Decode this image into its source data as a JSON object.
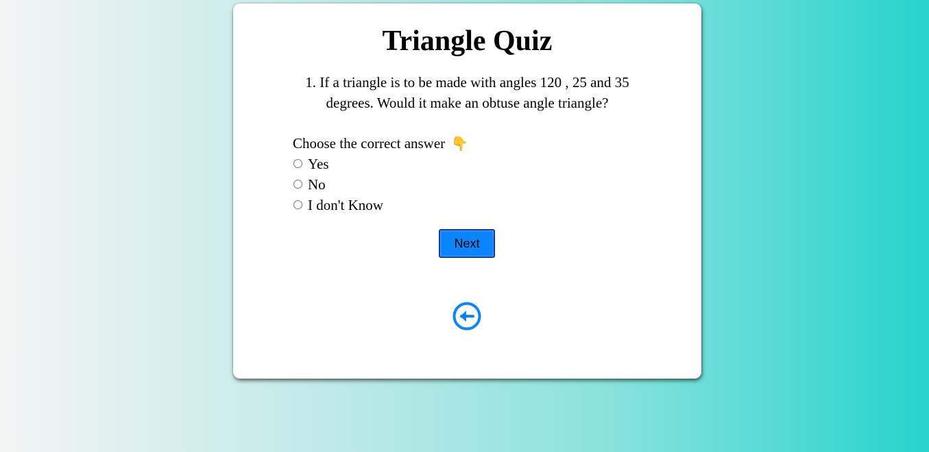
{
  "quiz": {
    "title": "Triangle Quiz",
    "question": "1. If a triangle is to be made with angles 120 , 25 and 35 degrees. Would it make an obtuse angle triangle?",
    "prompt": "Choose the correct answer",
    "prompt_emoji": "👇",
    "options": [
      "Yes",
      "No",
      "I don't Know"
    ],
    "next_label": "Next",
    "back_icon": "circle-arrow-left-icon"
  },
  "colors": {
    "accent": "#0a84ff",
    "button_border": "#0b3d91",
    "background_start": "#f3f4f4",
    "background_end": "#26d3cd"
  }
}
